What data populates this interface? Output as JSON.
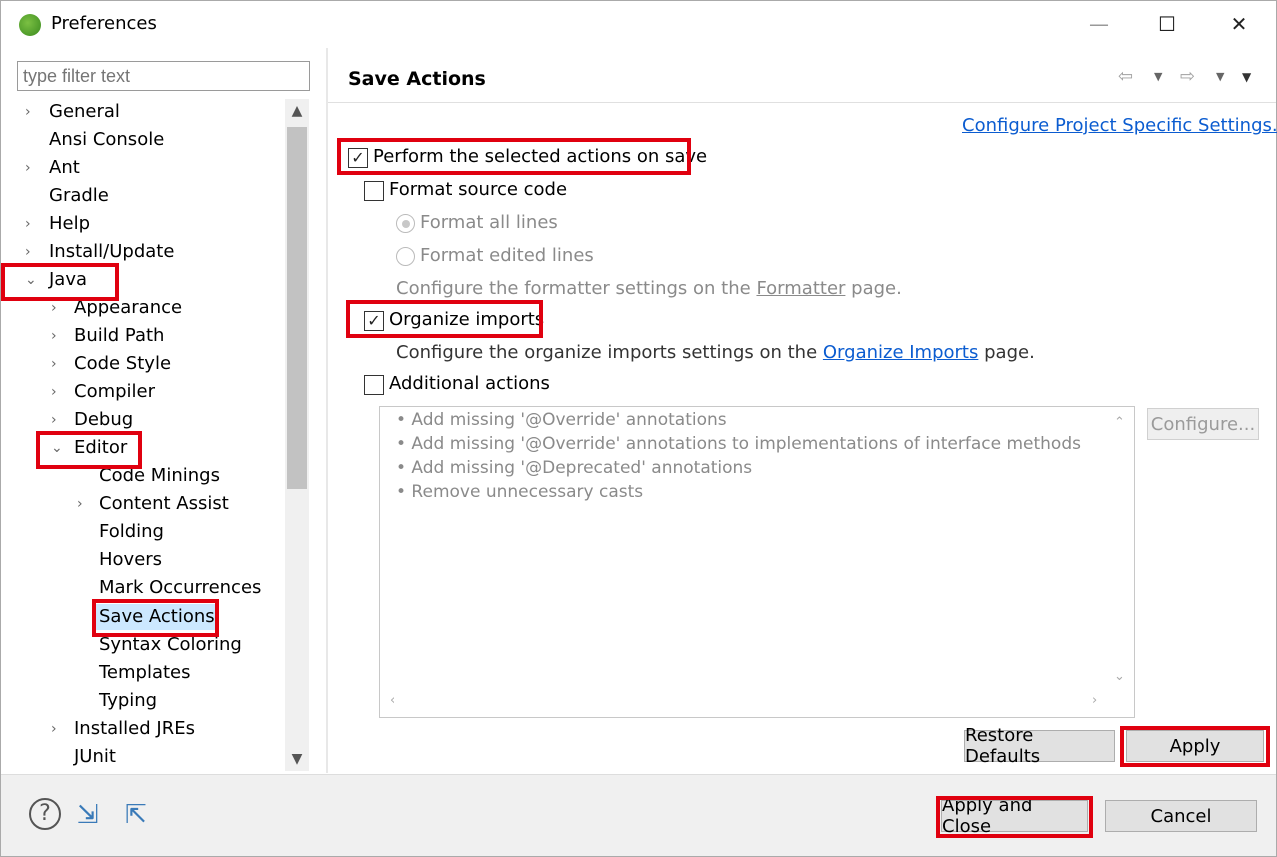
{
  "window": {
    "title": "Preferences",
    "minimize_glyph": "—",
    "maximize_glyph": "☐",
    "close_glyph": "✕"
  },
  "filter": {
    "placeholder": "type filter text"
  },
  "tree": [
    {
      "label": "General",
      "twisty": "›"
    },
    {
      "label": "Ansi Console",
      "twisty": ""
    },
    {
      "label": "Ant",
      "twisty": "›"
    },
    {
      "label": "Gradle",
      "twisty": ""
    },
    {
      "label": "Help",
      "twisty": "›"
    },
    {
      "label": "Install/Update",
      "twisty": "›"
    },
    {
      "label": "Java",
      "twisty": "⌄"
    },
    {
      "label": "Appearance",
      "twisty": "›"
    },
    {
      "label": "Build Path",
      "twisty": "›"
    },
    {
      "label": "Code Style",
      "twisty": "›"
    },
    {
      "label": "Compiler",
      "twisty": "›"
    },
    {
      "label": "Debug",
      "twisty": "›"
    },
    {
      "label": "Editor",
      "twisty": "⌄"
    },
    {
      "label": "Code Minings",
      "twisty": ""
    },
    {
      "label": "Content Assist",
      "twisty": "›"
    },
    {
      "label": "Folding",
      "twisty": ""
    },
    {
      "label": "Hovers",
      "twisty": ""
    },
    {
      "label": "Mark Occurrences",
      "twisty": ""
    },
    {
      "label": "Save Actions",
      "twisty": ""
    },
    {
      "label": "Syntax Coloring",
      "twisty": ""
    },
    {
      "label": "Templates",
      "twisty": ""
    },
    {
      "label": "Typing",
      "twisty": ""
    },
    {
      "label": "Installed JREs",
      "twisty": "›"
    },
    {
      "label": "JUnit",
      "twisty": ""
    }
  ],
  "page": {
    "title": "Save Actions",
    "project_link": "Configure Project Specific Settings...",
    "perform_label": "Perform the selected actions on save",
    "format_label": "Format source code",
    "format_all_label": "Format all lines",
    "format_edited_label": "Format edited lines",
    "formatter_prefix": "Configure the formatter settings on the",
    "formatter_link": "Formatter",
    "formatter_suffix": "page.",
    "organize_label": "Organize imports",
    "organize_prefix": "Configure the organize imports settings on the",
    "organize_link": "Organize Imports",
    "organize_suffix": "page.",
    "additional_label": "Additional actions",
    "additional_items": [
      "• Add missing '@Override' annotations",
      "• Add missing '@Override' annotations to implementations of interface methods",
      "• Add missing '@Deprecated' annotations",
      "• Remove unnecessary casts"
    ],
    "configure_button": "Configure...",
    "restore_button": "Restore Defaults",
    "apply_button": "Apply"
  },
  "footer": {
    "apply_close_button": "Apply and Close",
    "cancel_button": "Cancel"
  },
  "checkmark": "✓"
}
